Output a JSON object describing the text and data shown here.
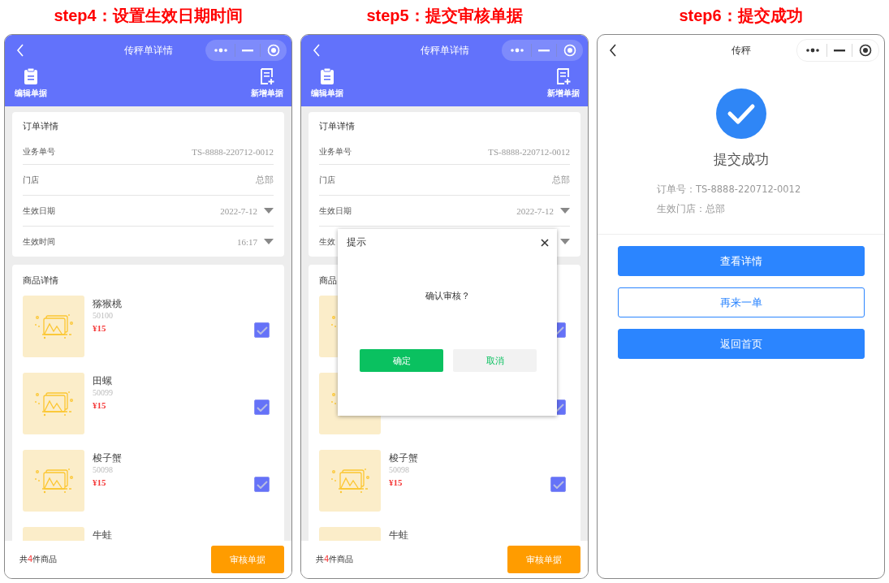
{
  "steps": [
    {
      "title": "step4：设置生效日期时间",
      "screen": {
        "kind": "detail",
        "nav_title": "传秤单详情",
        "toolbar": [
          {
            "label": "编辑单据"
          },
          {
            "label": "新增单据"
          }
        ],
        "order": {
          "title": "订单详情",
          "fields": [
            {
              "label": "业务单号",
              "value": "TS-8888-220712-0012",
              "dropdown": false
            },
            {
              "label": "门店",
              "value": "总部",
              "dropdown": false
            },
            {
              "label": "生效日期",
              "value": "2022-7-12",
              "dropdown": true
            },
            {
              "label": "生效时间",
              "value": "16:17",
              "dropdown": true
            }
          ]
        },
        "goods": {
          "title": "商品详情",
          "items": [
            {
              "name": "猕猴桃",
              "code": "50100",
              "price": "¥15",
              "checked": true
            },
            {
              "name": "田螺",
              "code": "50099",
              "price": "¥15",
              "checked": true
            },
            {
              "name": "梭子蟹",
              "code": "50098",
              "price": "¥15",
              "checked": true
            },
            {
              "name": "牛蛙"
            }
          ]
        },
        "footer": {
          "summary": "共**4**件商品",
          "button": "审核单据"
        }
      }
    },
    {
      "title": "step5：提交审核单据",
      "screen": {
        "kind": "detail",
        "nav_title": "传秤单详情",
        "toolbar": [
          {
            "label": "编辑单据"
          },
          {
            "label": "新增单据"
          }
        ],
        "order": {
          "title": "订单详情",
          "fields": [
            {
              "label": "业务单号",
              "value": "TS-8888-220712-0012",
              "dropdown": false
            },
            {
              "label": "门店",
              "value": "总部",
              "dropdown": false
            },
            {
              "label": "生效日期",
              "value": "2022-7-12",
              "dropdown": true
            },
            {
              "label": "生效",
              "dropdown": true
            }
          ]
        },
        "goods": {
          "title": "商品",
          "items": [
            {
              "checked": true
            },
            {
              "checked": true
            },
            {
              "name": "梭子蟹",
              "code": "50098",
              "price": "¥15",
              "checked": true
            },
            {
              "name": "牛蛙"
            }
          ]
        },
        "footer": {
          "summary": "共**4**件商品",
          "button": "审核单据"
        },
        "dialog": {
          "title": "提示",
          "message": "确认审核？",
          "buttons": [
            {
              "label": "确定",
              "kind": "primary"
            },
            {
              "label": "取消",
              "kind": "secondary"
            }
          ]
        }
      }
    },
    {
      "title": "step6：提交成功",
      "screen": {
        "kind": "success",
        "nav_title": "传秤",
        "heading": "提交成功",
        "info": [
          "订单号：TS-8888-220712-0012",
          "生效门店：总部"
        ],
        "buttons": [
          {
            "label": "查看详情",
            "kind": "primary"
          },
          {
            "label": "再来一单",
            "kind": "outline"
          },
          {
            "label": "返回首页",
            "kind": "primary"
          }
        ]
      }
    }
  ]
}
